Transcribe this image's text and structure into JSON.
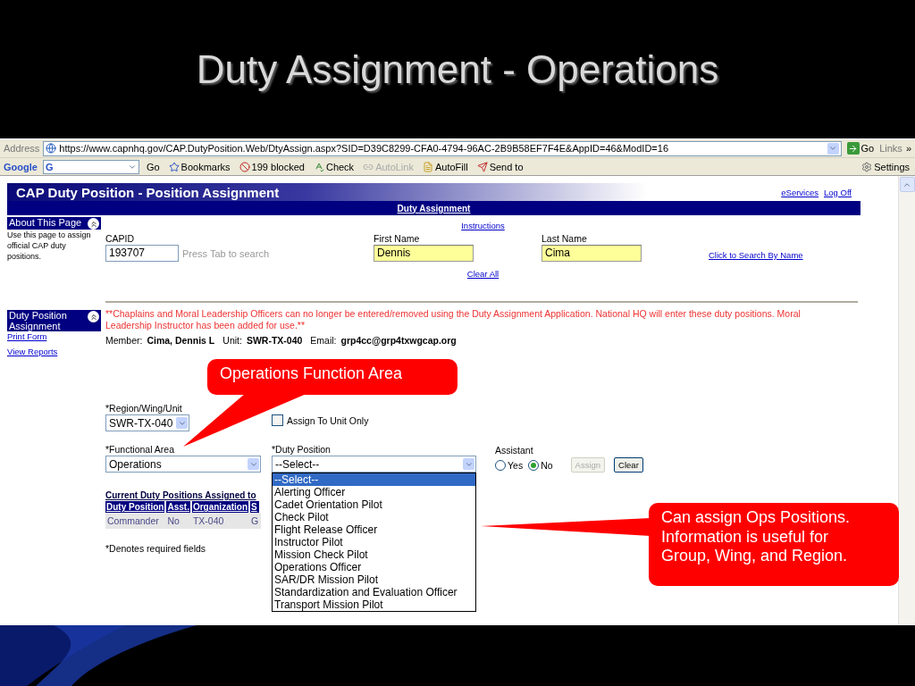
{
  "slide_title": "Duty Assignment - Operations",
  "address_bar": {
    "label": "Address",
    "url": "https://www.capnhq.gov/CAP.DutyPosition.Web/DtyAssign.aspx?SID=D39C8299-CFA0-4794-96AC-2B9B58EF7F4E&AppID=46&ModID=16",
    "go": "Go",
    "links": "Links",
    "more": "»"
  },
  "google_toolbar": {
    "brand": "Google",
    "search_value": "G",
    "go": "Go",
    "items": [
      {
        "kind": "star",
        "label": "Bookmarks",
        "disabled": false
      },
      {
        "kind": "block",
        "label": "199 blocked",
        "disabled": false
      },
      {
        "kind": "check",
        "label": "Check",
        "disabled": false
      },
      {
        "kind": "link",
        "label": "AutoLink",
        "disabled": true
      },
      {
        "kind": "fill",
        "label": "AutoFill",
        "disabled": false
      },
      {
        "kind": "send",
        "label": "Send to",
        "disabled": false
      }
    ],
    "settings": "Settings"
  },
  "page": {
    "title": "CAP Duty Position - Position Assignment",
    "header_links": [
      "eServices",
      "Log Off"
    ],
    "section_bar": "Duty Assignment",
    "sidebar": {
      "about_heading": "About This Page",
      "about_text": "Use this page to assign official CAP duty positions.",
      "nav_heading": "Duty Position Assignment",
      "links": [
        "Print Form",
        "View Reports"
      ]
    },
    "instructions_link": "Instructions",
    "search_fields": [
      {
        "label": "CAPID",
        "value": "193707",
        "highlighted": false
      },
      {
        "label": "First Name",
        "value": "Dennis",
        "highlighted": true
      },
      {
        "label": "Last Name",
        "value": "Cima",
        "highlighted": true
      }
    ],
    "search_hint": "Press Tab to search",
    "search_link": "Click to Search By Name",
    "clear_link": "Clear All",
    "notice": "**Chaplains and Moral Leadership Officers can no longer be entered/removed using the Duty Assignment Application. National HQ will enter these duty positions. Moral Leadership Instructor has been added for use.**",
    "member": [
      {
        "label": "Member:",
        "value": "Cima, Dennis L"
      },
      {
        "label": "Unit:",
        "value": "SWR-TX-040"
      },
      {
        "label": "Email:",
        "value": "grp4cc@grp4txwgcap.org"
      }
    ],
    "region": {
      "label": "*Region/Wing/Unit",
      "value": "SWR-TX-040"
    },
    "assign_unit_only": {
      "label": "Assign To Unit Only",
      "checked": false
    },
    "functional_area": {
      "label": "*Functional Area",
      "value": "Operations"
    },
    "duty_position": {
      "label": "*Duty Position",
      "value": "--Select--",
      "options": [
        {
          "label": "--Select--",
          "selected": true
        },
        {
          "label": "Alerting Officer",
          "selected": false
        },
        {
          "label": "Cadet Orientation Pilot",
          "selected": false
        },
        {
          "label": "Check Pilot",
          "selected": false
        },
        {
          "label": "Flight Release Officer",
          "selected": false
        },
        {
          "label": "Instructor Pilot",
          "selected": false
        },
        {
          "label": "Mission Check Pilot",
          "selected": false
        },
        {
          "label": "Operations Officer",
          "selected": false
        },
        {
          "label": "SAR/DR Mission Pilot",
          "selected": false
        },
        {
          "label": "Standardization and Evaluation Officer",
          "selected": false
        },
        {
          "label": "Transport Mission Pilot",
          "selected": false
        }
      ]
    },
    "assistant": {
      "label": "Assistant",
      "options": [
        {
          "label": "Yes",
          "selected": false
        },
        {
          "label": "No",
          "selected": true
        }
      ]
    },
    "buttons": [
      {
        "label": "Assign",
        "disabled": true
      },
      {
        "label": "Clear",
        "disabled": false
      }
    ],
    "current": {
      "heading": "Current Duty Positions Assigned to",
      "columns": [
        "Duty Position",
        "Asst.",
        "Organization",
        "S"
      ],
      "rows": [
        [
          "Commander",
          "No",
          "TX-040",
          "G"
        ]
      ]
    },
    "required_note": "*Denotes required fields"
  },
  "callouts": [
    {
      "text": "Operations Function Area"
    },
    {
      "text": "Can assign Ops Positions. Information is useful for Group, Wing, and Region."
    }
  ]
}
